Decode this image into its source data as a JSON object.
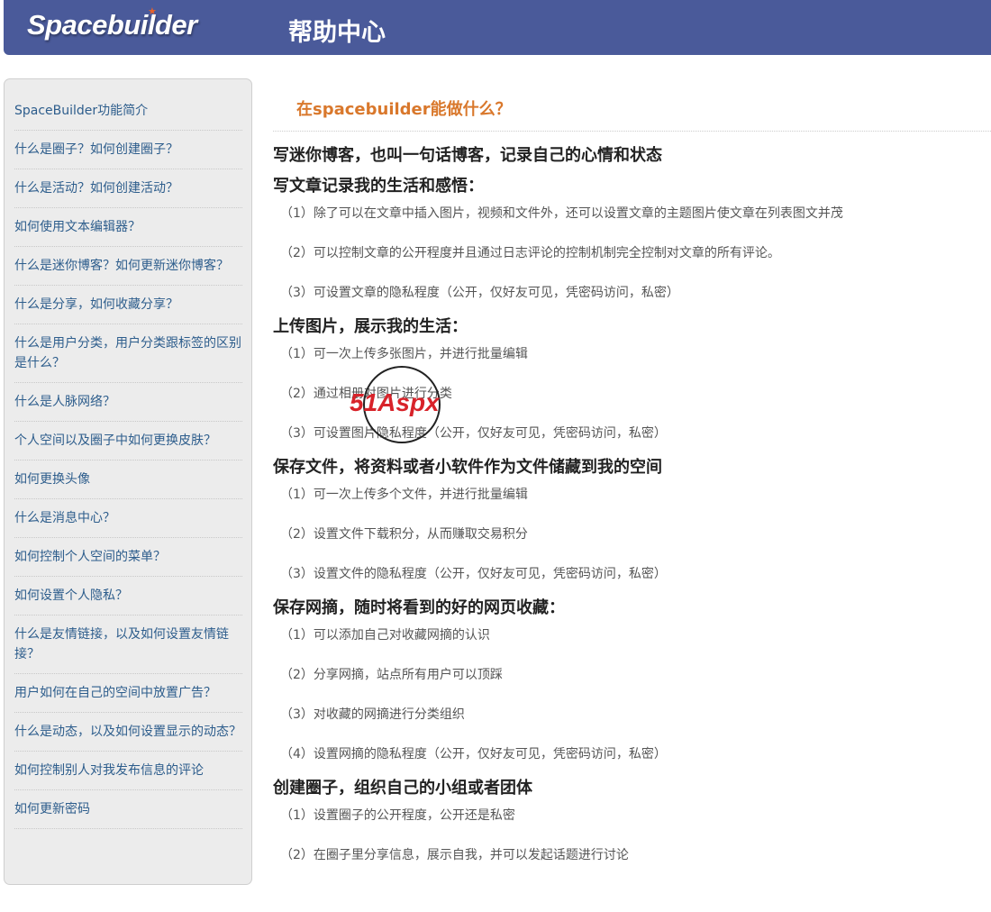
{
  "header": {
    "logo": "Spacebuilder",
    "title": "帮助中心"
  },
  "sidebar": {
    "items": [
      "SpaceBuilder功能简介",
      "什么是圈子？如何创建圈子？",
      "什么是活动？如何创建活动？",
      "如何使用文本编辑器？",
      "什么是迷你博客？如何更新迷你博客？",
      "什么是分享，如何收藏分享？",
      "什么是用户分类，用户分类跟标签的区别是什么？",
      "什么是人脉网络？",
      "个人空间以及圈子中如何更换皮肤？",
      "如何更换头像",
      "什么是消息中心？",
      "如何控制个人空间的菜单？",
      "如何设置个人隐私？",
      "什么是友情链接，以及如何设置友情链接？",
      "用户如何在自己的空间中放置广告？",
      "什么是动态，以及如何设置显示的动态？",
      "如何控制别人对我发布信息的评论",
      "如何更新密码"
    ]
  },
  "main": {
    "heading": "在spacebuilder能做什么？",
    "sections": [
      {
        "title": "写迷你博客，也叫一句话博客，记录自己的心情和状态",
        "items": []
      },
      {
        "title": "写文章记录我的生活和感悟：",
        "items": [
          "（1）除了可以在文章中插入图片，视频和文件外，还可以设置文章的主题图片使文章在列表图文并茂",
          "（2）可以控制文章的公开程度并且通过日志评论的控制机制完全控制对文章的所有评论。",
          "（3）可设置文章的隐私程度（公开，仅好友可见，凭密码访问，私密）"
        ]
      },
      {
        "title": "上传图片，展示我的生活：",
        "items": [
          "（1）可一次上传多张图片，并进行批量编辑",
          "（2）通过相册对图片进行分类",
          "（3）可设置图片隐私程度（公开，仅好友可见，凭密码访问，私密）"
        ]
      },
      {
        "title": "保存文件，将资料或者小软件作为文件储藏到我的空间",
        "items": [
          "（1）可一次上传多个文件，并进行批量编辑",
          "（2）设置文件下载积分，从而赚取交易积分",
          "（3）设置文件的隐私程度（公开，仅好友可见，凭密码访问，私密）"
        ]
      },
      {
        "title": "保存网摘，随时将看到的好的网页收藏：",
        "items": [
          "（1）可以添加自己对收藏网摘的认识",
          "（2）分享网摘，站点所有用户可以顶踩",
          "（3）对收藏的网摘进行分类组织",
          "（4）设置网摘的隐私程度（公开，仅好友可见，凭密码访问，私密）"
        ]
      },
      {
        "title": "创建圈子，组织自己的小组或者团体",
        "items": [
          "（1）设置圈子的公开程度，公开还是私密",
          "（2）在圈子里分享信息，展示自我，并可以发起话题进行讨论"
        ]
      }
    ]
  },
  "watermark": {
    "text": "51Aspx"
  }
}
